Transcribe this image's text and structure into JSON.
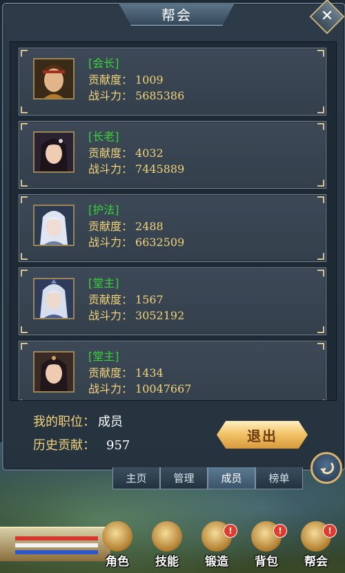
{
  "window": {
    "title": "帮会",
    "close_icon": "close-icon"
  },
  "members": [
    {
      "role": "[会长]",
      "contribution_label": "贡献度：",
      "contribution": "1009",
      "power_label": "战斗力：",
      "power": "5685386"
    },
    {
      "role": "[长老]",
      "contribution_label": "贡献度：",
      "contribution": "4032",
      "power_label": "战斗力：",
      "power": "7445889"
    },
    {
      "role": "[护法]",
      "contribution_label": "贡献度：",
      "contribution": "2488",
      "power_label": "战斗力：",
      "power": "6632509"
    },
    {
      "role": "[堂主]",
      "contribution_label": "贡献度：",
      "contribution": "1567",
      "power_label": "战斗力：",
      "power": "3052192"
    },
    {
      "role": "[堂主]",
      "contribution_label": "贡献度：",
      "contribution": "1434",
      "power_label": "战斗力：",
      "power": "10047667"
    }
  ],
  "my_info": {
    "position_label": "我的职位：",
    "position": "成员",
    "history_label": "历史贡献：",
    "history": "957"
  },
  "exit_button": "退出",
  "tabs": [
    {
      "label": "主页",
      "active": false
    },
    {
      "label": "管理",
      "active": false
    },
    {
      "label": "成员",
      "active": true
    },
    {
      "label": "榜单",
      "active": false
    }
  ],
  "dock": [
    {
      "label": "角色",
      "icon": "character-icon",
      "alert": false
    },
    {
      "label": "技能",
      "icon": "skill-icon",
      "alert": false
    },
    {
      "label": "锻造",
      "icon": "forge-icon",
      "alert": true
    },
    {
      "label": "背包",
      "icon": "bag-icon",
      "alert": true
    },
    {
      "label": "帮会",
      "icon": "guild-icon",
      "alert": true
    }
  ],
  "badge_text": "!",
  "colors": {
    "role": "#3ad23a",
    "stat": "#f3d37a",
    "accent_gold": "#d7b36b"
  }
}
